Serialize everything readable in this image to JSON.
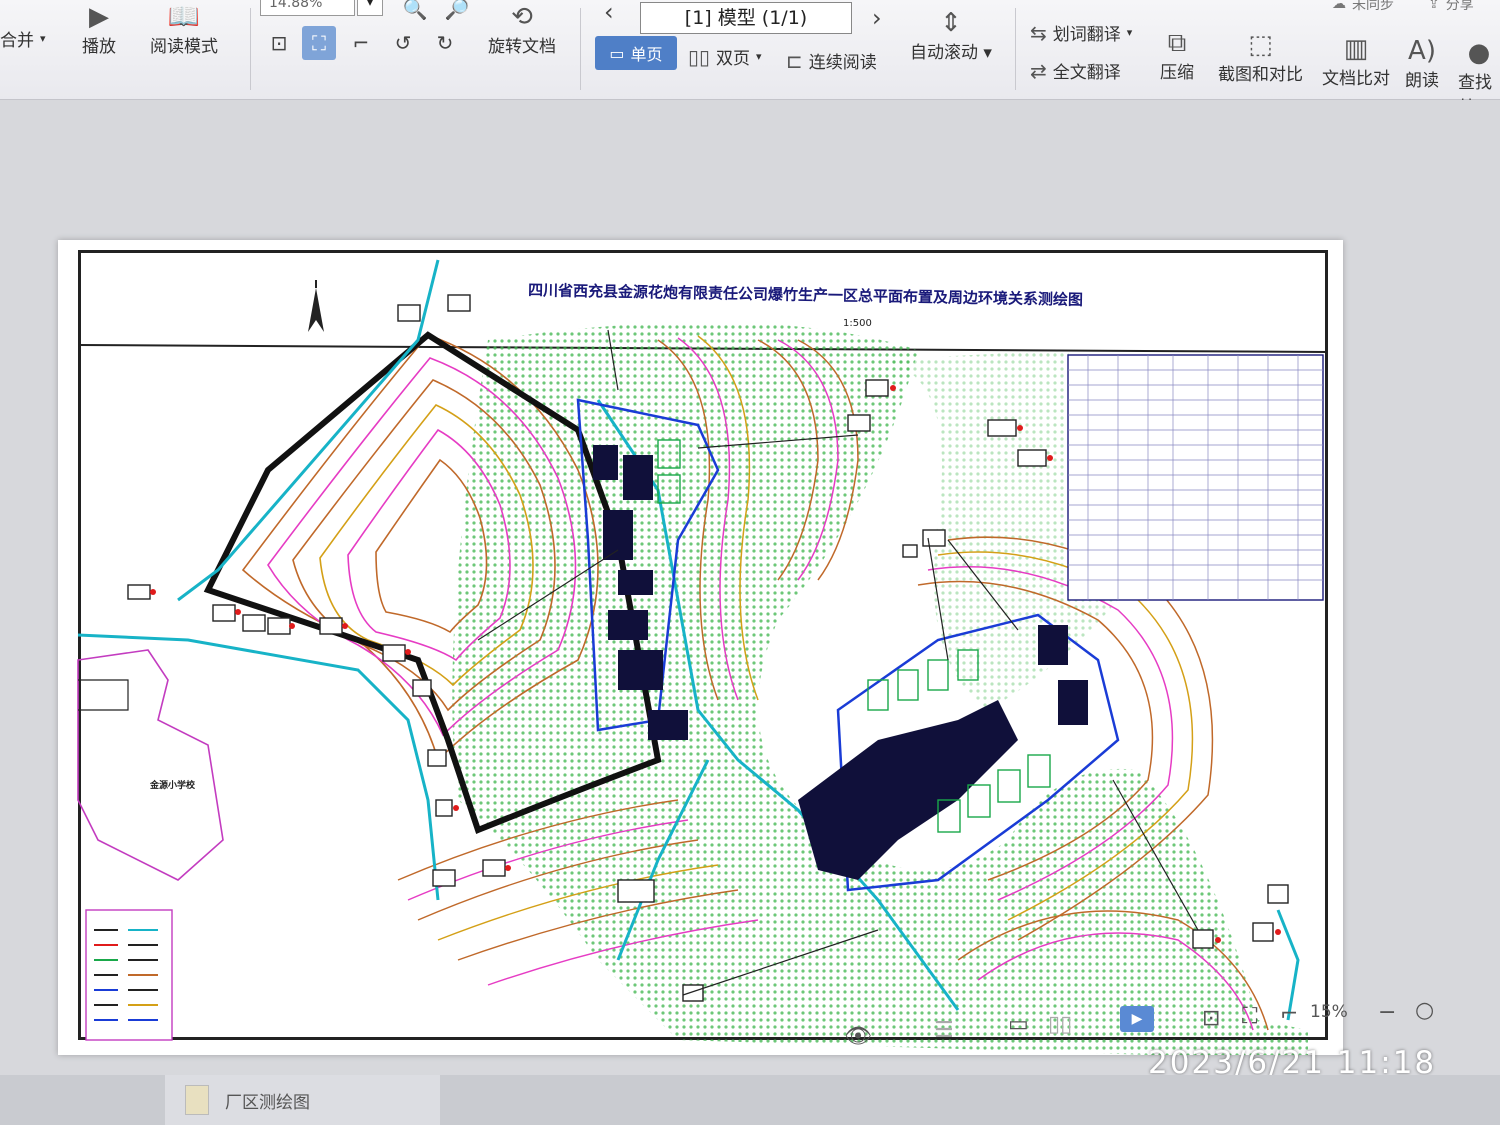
{
  "toolbar": {
    "merge_label": "合并",
    "play_label": "播放",
    "read_mode_label": "阅读模式",
    "zoom_value": "14.88%",
    "rotate_label": "旋转文档",
    "model_tab": "[1] 模型 (1/1)",
    "single_page_label": "单页",
    "double_page_label": "双页",
    "continuous_label": "连续阅读",
    "auto_scroll_label": "自动滚动",
    "word_translate_label": "划词翻译",
    "full_translate_label": "全文翻译",
    "compress_label": "压缩",
    "screenshot_compare_label": "截图和对比",
    "doc_compare_label": "文档比对",
    "read_aloud_label": "朗读",
    "find_label": "查找替",
    "unsynced_label": "未同步",
    "share_label": "分享"
  },
  "drawing": {
    "title": "四川省西充县金源花炮有限责任公司爆竹生产一区总平面布置及周边环境关系测绘图",
    "scale": "1:500",
    "school_label": "金源小学校"
  },
  "bottom": {
    "zoom_percent": "15%",
    "timestamp": "2023/6/21  11:18",
    "taskbar_item": "厂区测绘图"
  }
}
